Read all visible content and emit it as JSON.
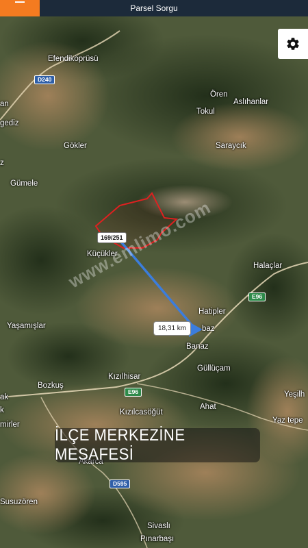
{
  "header": {
    "title": "Parsel Sorgu"
  },
  "settings": {
    "icon": "gear-icon"
  },
  "parcel": {
    "label": "169/251",
    "outline_color": "#e02020"
  },
  "route": {
    "distance": "18,31 km",
    "line_color": "#3b7ddd"
  },
  "watermark": "www.emlimo.com",
  "caption": "İLÇE MERKEZİNE MESAFESİ",
  "roads": {
    "d240": "D240",
    "d595": "D595",
    "e96_a": "E96",
    "e96_b": "E96"
  },
  "places": {
    "efendikoprusu": "Efendiköprüsü",
    "oren": "Ören",
    "aslihanlar": "Aslıhanlar",
    "tokul": "Tokul",
    "an": "an",
    "gediz": "gediz",
    "gokler": "Gökler",
    "saraycik": "Saraycık",
    "z": "z",
    "gumele": "Gümele",
    "kucukler": "Küçükler",
    "halaclar": "Halaçlar",
    "hatipler": "Hatipler",
    "yasamislar": "Yaşamışlar",
    "baz": "baz",
    "banaz": "Banaz",
    "gullucam": "Güllüçam",
    "kizilhisar": "Kızılhisar",
    "bozkus": "Bozkuş",
    "ahat": "Ahat",
    "yesilh": "Yeşilh",
    "ak": "ak",
    "k": "k",
    "kizilcasogut": "Kızılcasöğüt",
    "yaztepe": "Yaz tepe",
    "mirler": "mirler",
    "akarca": "Akarca",
    "susuzoren": "Susuzören",
    "sivasli": "Sivaslı",
    "pinarbasi": "Pınarbaşı"
  }
}
